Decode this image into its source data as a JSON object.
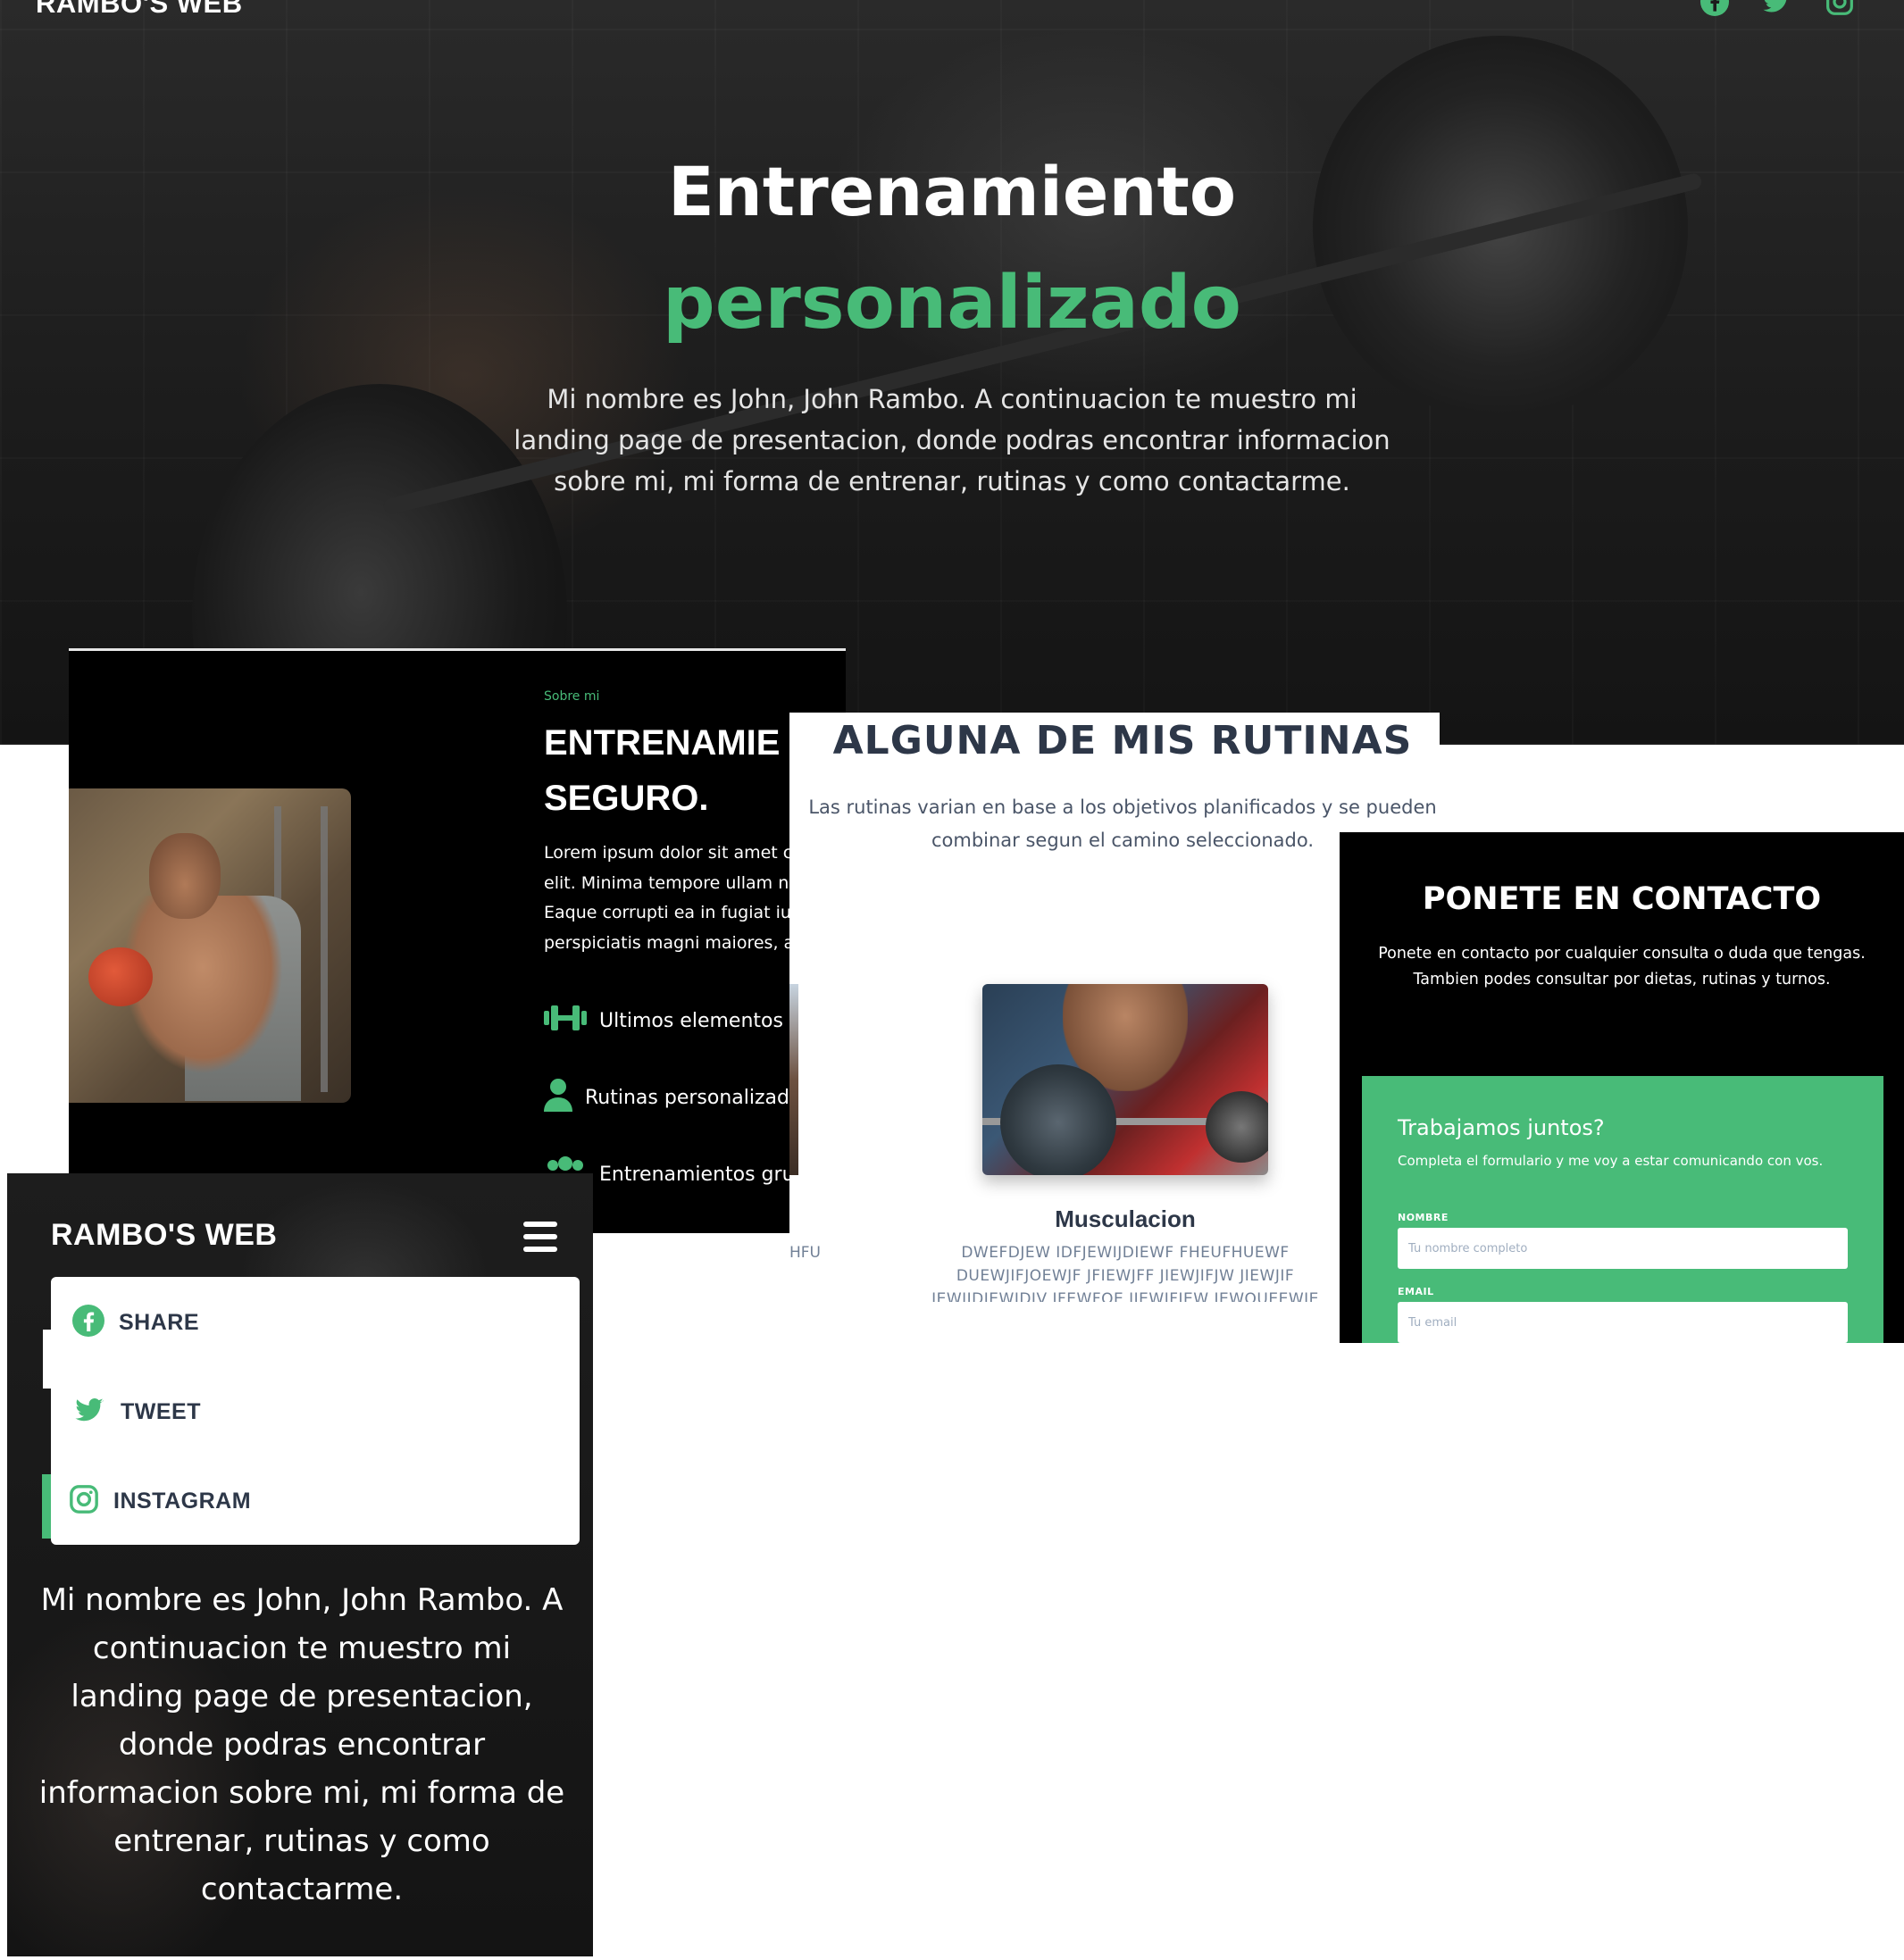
{
  "hero": {
    "logo": "RAMBO'S WEB",
    "title_line1": "Entrenamiento",
    "title_line2": "personalizado",
    "description": "Mi nombre es John, John Rambo. A continuacion te muestro mi landing page de presentacion, donde podras encontrar informacion sobre mi, mi forma de entrenar, rutinas y como contactarme.",
    "social_icons": [
      "facebook-icon",
      "twitter-icon",
      "instagram-icon"
    ]
  },
  "about": {
    "eyebrow": "Sobre mi",
    "title_line1": "ENTRENAMIE",
    "title_line2": "SEGURO.",
    "text_lines": [
      "Lorem ipsum dolor sit amet co",
      "elit. Minima tempore ullam nu",
      "Eaque corrupti ea in fugiat iur",
      "perspiciatis magni maiores, ali"
    ],
    "features": [
      {
        "icon": "dumbbell-icon",
        "label": "Ultimos elementos de"
      },
      {
        "icon": "user-icon",
        "label": "Rutinas personalizadas"
      },
      {
        "icon": "group-icon",
        "label": "Entrenamientos grup"
      }
    ]
  },
  "routines": {
    "title": "ALGUNA DE MIS RUTINAS",
    "subtitle": "Las rutinas varian en base a los objetivos planificados y se pueden combinar segun el camino seleccionado.",
    "card": {
      "name": "Musculacion",
      "description": "DWEFDJEW IDFJEWIJDIEWF FHEUFHUEWF DUEWJIFJOEWJF JFIEWJFF JIEWJIFJW JIEWJIF JEWIJDIEWIDIV JFEWFOE JIEWJFIEW JEWOUEEWJE"
    },
    "left_cut_text": "HFU FWE"
  },
  "contact": {
    "title": "PONETE EN CONTACTO",
    "description": "Ponete en contacto por cualquier consulta o duda que tengas. Tambien podes consultar por dietas, rutinas y turnos.",
    "card_title": "Trabajamos juntos?",
    "card_subtitle": "Completa el formulario y me voy a estar comunicando con vos.",
    "fields": [
      {
        "label": "NOMBRE",
        "placeholder": "Tu nombre completo"
      },
      {
        "label": "EMAIL",
        "placeholder": "Tu email"
      }
    ]
  },
  "mobile": {
    "logo": "RAMBO'S WEB",
    "menu": [
      {
        "icon": "facebook-icon",
        "label": "SHARE"
      },
      {
        "icon": "twitter-icon",
        "label": "TWEET"
      },
      {
        "icon": "instagram-icon",
        "label": "INSTAGRAM"
      }
    ],
    "description": "Mi nombre es John, John Rambo. A continuacion te muestro mi landing page de presentacion, donde podras encontrar informacion sobre mi, mi forma de entrenar, rutinas y como contactarme."
  },
  "colors": {
    "accent": "#48bb78",
    "dark": "#000000",
    "heading": "#2d3748",
    "muted": "#718096"
  }
}
